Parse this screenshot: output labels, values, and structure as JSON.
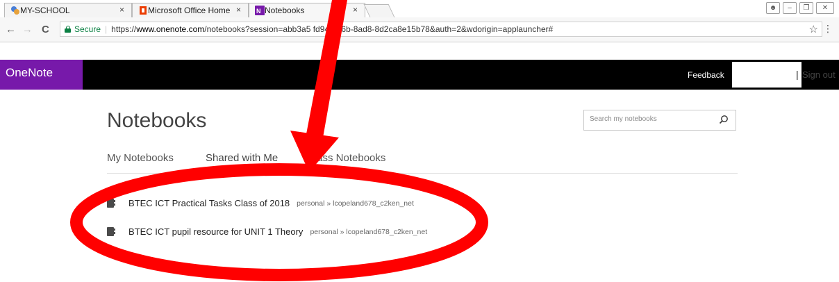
{
  "browser": {
    "tabs": [
      {
        "title": "MY-SCHOOL",
        "close": "×",
        "favicon": "my-school-icon"
      },
      {
        "title": "Microsoft Office Home",
        "close": "×",
        "favicon": "office-icon"
      },
      {
        "title": "Notebooks",
        "close": "×",
        "favicon": "onenote-icon",
        "active": true
      }
    ],
    "window_buttons": {
      "user": "👤",
      "minimize": "–",
      "maximize": "❐",
      "close": "✕"
    },
    "nav": {
      "back": "←",
      "forward": "→",
      "reload": "C"
    },
    "address": {
      "secure_label": "Secure",
      "separator": "|",
      "scheme": "https://",
      "host": "www.onenote.com",
      "path": "/notebooks?session=abb3a5 fd94-416b-8ad8-8d2ca8e15b78&auth=2&wdorigin=applauncher#"
    },
    "bookmark_icon": "☆",
    "menu_icon": "⋮"
  },
  "app": {
    "brand": "OneNote",
    "feedback": "Feedback",
    "separator": "|",
    "sign_out": "Sign out"
  },
  "page": {
    "title": "Notebooks",
    "search_placeholder": "Search my notebooks",
    "tabs": [
      {
        "label": "My Notebooks",
        "active": false
      },
      {
        "label": "Shared with Me",
        "active": true
      },
      {
        "label": "Class Notebooks",
        "active": false
      }
    ],
    "notebooks": [
      {
        "name": "BTEC ICT Practical Tasks Class of 2018",
        "location": "personal » lcopeland678_c2ken_net"
      },
      {
        "name": "BTEC ICT pupil resource for UNIT 1 Theory",
        "location": "personal » lcopeland678_c2ken_net"
      }
    ]
  },
  "colors": {
    "brand_purple": "#7719aa",
    "app_bar": "#000000",
    "annotation_red": "#ff0000",
    "secure_green": "#0b8043"
  }
}
